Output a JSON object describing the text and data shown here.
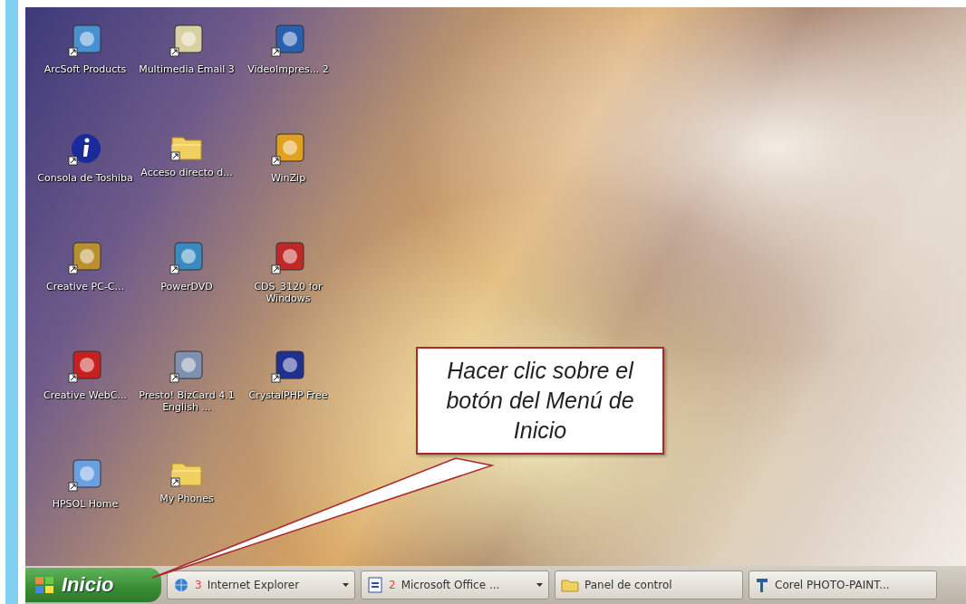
{
  "desktop": {
    "icons": [
      {
        "label": "ArcSoft Products",
        "kind": "app"
      },
      {
        "label": "Multimedia Email 3",
        "kind": "app"
      },
      {
        "label": "VideoImpres... 2",
        "kind": "app"
      },
      {
        "label": "Consola de Toshiba",
        "kind": "info"
      },
      {
        "label": "Acceso directo d...",
        "kind": "folder"
      },
      {
        "label": "WinZip",
        "kind": "app"
      },
      {
        "label": "Creative PC-C...",
        "kind": "app"
      },
      {
        "label": "PowerDVD",
        "kind": "app"
      },
      {
        "label": "CDS_3120 for Windows",
        "kind": "app"
      },
      {
        "label": "Creative WebC...",
        "kind": "app"
      },
      {
        "label": "Presto! BizCard 4.1 English ...",
        "kind": "app"
      },
      {
        "label": "CrystalPHP Free",
        "kind": "app"
      },
      {
        "label": "HPSOL Home",
        "kind": "app"
      },
      {
        "label": "My Phones",
        "kind": "folder"
      }
    ]
  },
  "callout": {
    "text": "Hacer clic sobre el botón del Menú de Inicio"
  },
  "taskbar": {
    "start": "Inicio",
    "items": [
      {
        "count": "3",
        "label": "Internet Explorer",
        "kind": "browser",
        "grouped": true
      },
      {
        "count": "2",
        "label": "Microsoft Office ...",
        "kind": "document",
        "grouped": true
      },
      {
        "label": "Panel de control",
        "kind": "folder",
        "grouped": false
      },
      {
        "label": "Corel PHOTO-PAINT...",
        "kind": "paint",
        "grouped": false
      }
    ]
  }
}
